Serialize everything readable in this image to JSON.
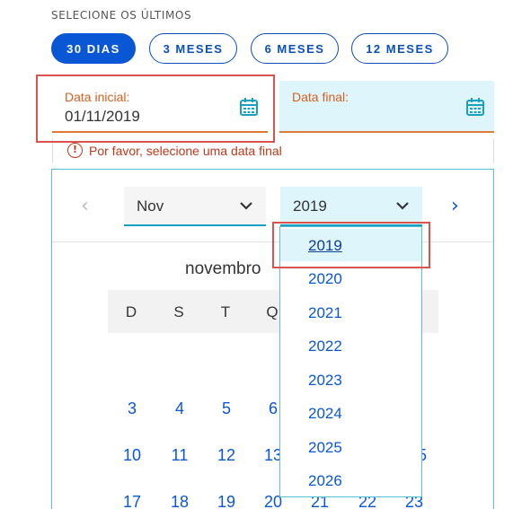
{
  "filter": {
    "section_label": "SELECIONE OS ÚLTIMOS",
    "options": [
      {
        "label": "30 DIAS",
        "active": true
      },
      {
        "label": "3 MESES",
        "active": false
      },
      {
        "label": "6 MESES",
        "active": false
      },
      {
        "label": "12 MESES",
        "active": false
      }
    ]
  },
  "start_date": {
    "label": "Data inicial:",
    "value": "01/11/2019",
    "icon": "calendar-icon"
  },
  "end_date": {
    "label": "Data final:",
    "value": "",
    "icon": "calendar-icon"
  },
  "error": {
    "icon": "!",
    "text": "Por favor, selecione uma data final"
  },
  "calendar": {
    "prev_icon": "‹",
    "next_icon": "›",
    "month_select": "Nov",
    "year_select": "2019",
    "month_title": "novembro",
    "weekdays": [
      "D",
      "S",
      "T",
      "Q"
    ],
    "visible_days": [
      "3",
      "4",
      "5",
      "6",
      "10",
      "11",
      "12",
      "13",
      "17",
      "18",
      "19",
      "20",
      "21",
      "22",
      "23",
      "5"
    ]
  },
  "year_dropdown": {
    "options": [
      "2019",
      "2020",
      "2021",
      "2022",
      "2023",
      "2024",
      "2025",
      "2026"
    ],
    "selected": "2019"
  },
  "colors": {
    "primary": "#0a57d6",
    "accent_orange": "#e07a3a",
    "light_blue": "#dff5fc",
    "error_red": "#c0391b",
    "highlight_red": "#d9534f"
  }
}
